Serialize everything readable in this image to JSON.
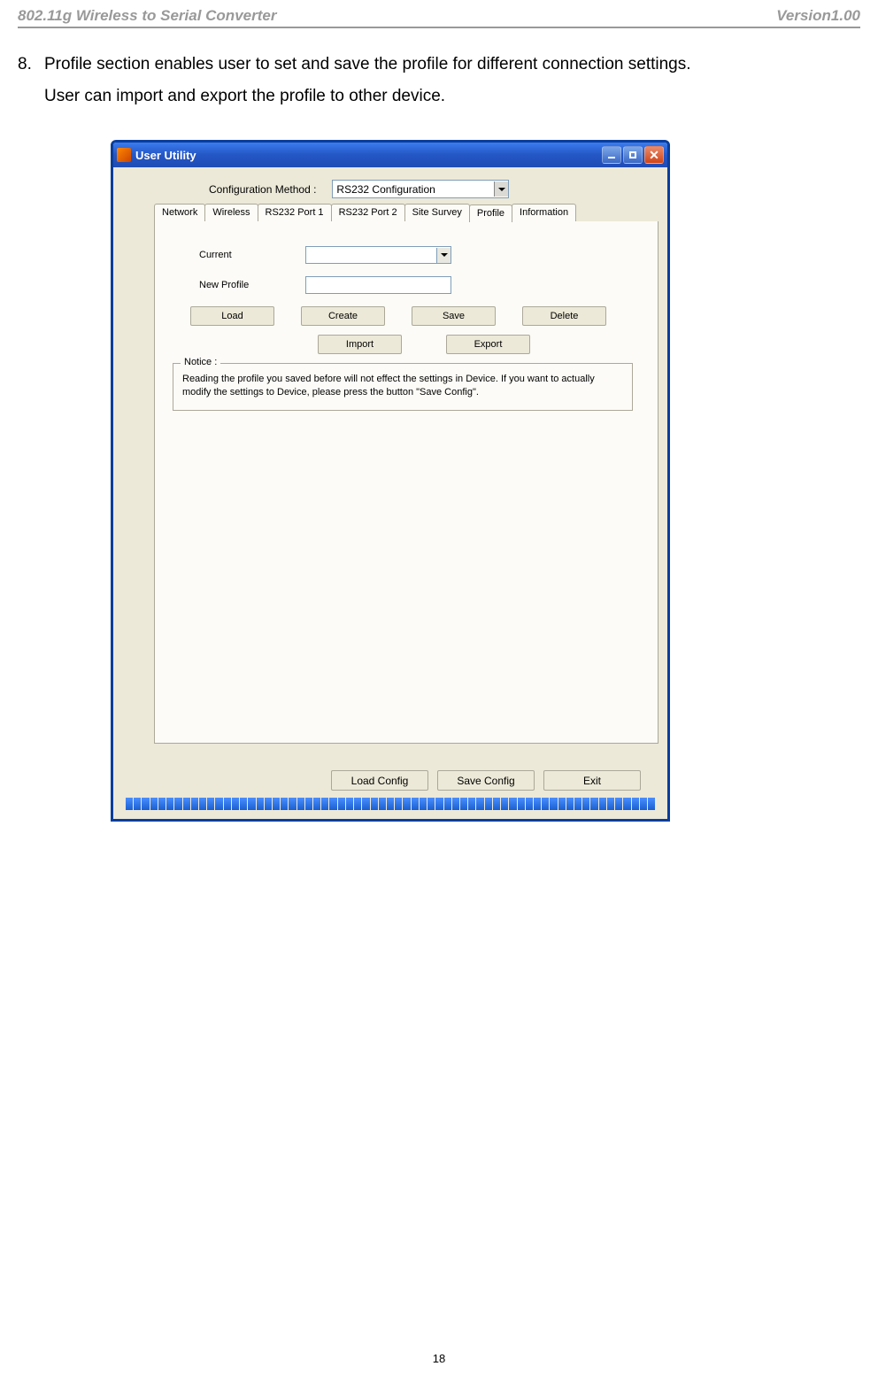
{
  "header": {
    "left": "802.11g Wireless to Serial Converter",
    "right": "Version1.00"
  },
  "instruction": {
    "number": "8.",
    "line1": "Profile section enables user to set and save the profile for different connection settings.",
    "line2": "User can import and export the profile to other device."
  },
  "window": {
    "title": "User Utility",
    "config_method_label": "Configuration Method :",
    "config_method_value": "RS232 Configuration",
    "tabs": [
      "Network",
      "Wireless",
      "RS232 Port 1",
      "RS232 Port 2",
      "Site Survey",
      "Profile",
      "Information"
    ],
    "active_tab": "Profile",
    "profile": {
      "current_label": "Current",
      "current_value": "",
      "new_profile_label": "New Profile",
      "new_profile_value": "",
      "buttons_row1": {
        "load": "Load",
        "create": "Create",
        "save": "Save",
        "delete": "Delete"
      },
      "buttons_row2": {
        "import": "Import",
        "export": "Export"
      },
      "notice_title": "Notice :",
      "notice_text": "Reading the profile you saved before will not effect the settings in Device. If you want to actually modify the settings to Device, please press the button \"Save Config\"."
    },
    "bottom_buttons": {
      "load_config": "Load Config",
      "save_config": "Save Config",
      "exit": "Exit"
    }
  },
  "page_number": "18"
}
